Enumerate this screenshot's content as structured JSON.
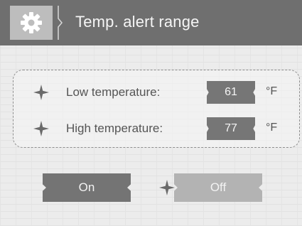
{
  "header": {
    "icon": "gear-icon",
    "title": "Temp. alert range"
  },
  "panel": {
    "rows": [
      {
        "label": "Low temperature:",
        "value": "61",
        "unit": "°F",
        "icon": "star-bullet-icon"
      },
      {
        "label": "High temperature:",
        "value": "77",
        "unit": "°F",
        "icon": "star-bullet-icon"
      }
    ]
  },
  "toggle": {
    "on_label": "On",
    "off_label": "Off",
    "selected": "On"
  },
  "colors": {
    "header_bg": "#6f6f6f",
    "icon_box": "#bdbdbd",
    "value_bg": "#767676",
    "button_on": "#747474",
    "button_off": "#b3b3b3",
    "text": "#555555"
  }
}
